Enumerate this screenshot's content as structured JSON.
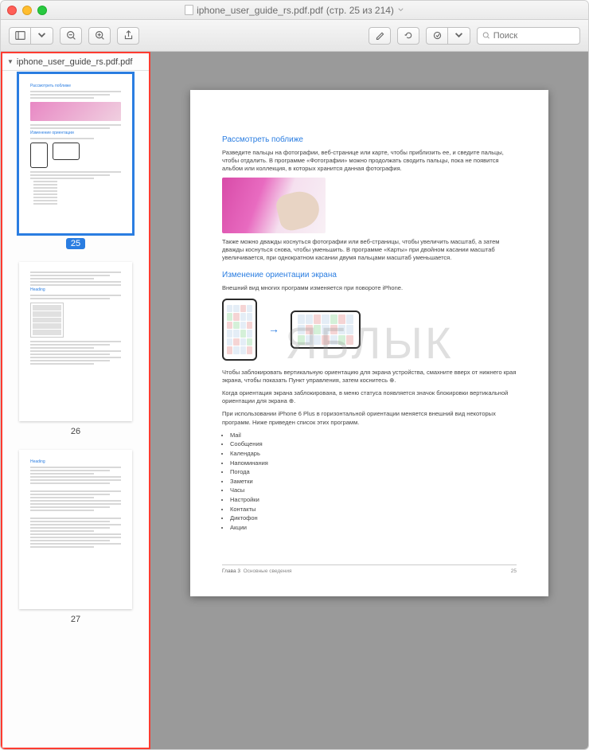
{
  "window": {
    "title_filename": "iphone_user_guide_rs.pdf.pdf",
    "title_pageinfo": "(стр. 25 из 214)"
  },
  "search": {
    "placeholder": "Поиск"
  },
  "sidebar": {
    "filename": "iphone_user_guide_rs.pdf.pdf",
    "pages": [
      {
        "num": "25",
        "selected": true
      },
      {
        "num": "26",
        "selected": false
      },
      {
        "num": "27",
        "selected": false
      }
    ]
  },
  "page": {
    "h1": "Рассмотреть поближе",
    "p1": "Разведите пальцы на фотографии, веб-странице или карте, чтобы приблизить ее, и сведите пальцы, чтобы отдалить. В программе «Фотографии» можно продолжать сводить пальцы, пока не появится альбом или коллекция, в которых хранится данная фотография.",
    "p2": "Также можно дважды коснуться фотографии или веб-страницы, чтобы увеличить масштаб, а затем дважды коснуться снова, чтобы уменьшить. В программе «Карты» при двойном касании масштаб увеличивается, при однократном касании двумя пальцами масштаб уменьшается.",
    "h2": "Изменение ориентации экрана",
    "p3": "Внешний вид многих программ изменяется при повороте iPhone.",
    "p4": "Чтобы заблокировать вертикальную ориентацию для экрана устройства, смахните вверх от нижнего края экрана, чтобы показать Пункт управления, затем коснитесь ⊕.",
    "p5": "Когда ориентация экрана заблокирована, в меню статуса появляется значок блокировки вертикальной ориентации для экрана ⊕.",
    "p6": "При использовании iPhone 6 Plus в горизонтальной ориентации меняется внешний вид некоторых программ. Ниже приведен список этих программ.",
    "list": [
      "Mail",
      "Сообщения",
      "Календарь",
      "Напоминания",
      "Погода",
      "Заметки",
      "Часы",
      "Настройки",
      "Контакты",
      "Диктофон",
      "Акции"
    ],
    "footer_chapter": "Глава 3",
    "footer_section": "Основные сведения",
    "footer_pagenum": "25"
  },
  "watermark": "ЯБЛЫК"
}
